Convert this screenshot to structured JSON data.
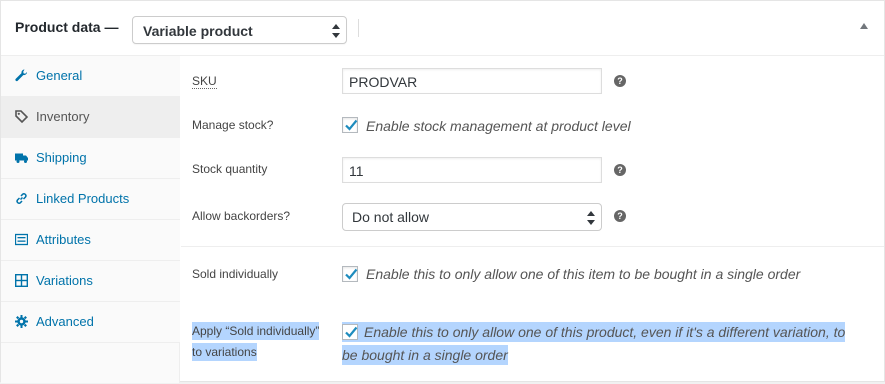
{
  "header": {
    "title": "Product data —",
    "product_type": "Variable product"
  },
  "tabs": [
    {
      "label": "General",
      "icon": "wrench-icon",
      "active": false
    },
    {
      "label": "Inventory",
      "icon": "tag-icon",
      "active": true
    },
    {
      "label": "Shipping",
      "icon": "truck-icon",
      "active": false
    },
    {
      "label": "Linked Products",
      "icon": "link-icon",
      "active": false
    },
    {
      "label": "Attributes",
      "icon": "list-icon",
      "active": false
    },
    {
      "label": "Variations",
      "icon": "grid-icon",
      "active": false
    },
    {
      "label": "Advanced",
      "icon": "gear-icon",
      "active": false
    }
  ],
  "inventory": {
    "sku_label": "SKU",
    "sku_value": "PRODVAR",
    "manage_stock_label": "Manage stock?",
    "manage_stock_desc": "Enable stock management at product level",
    "manage_stock_checked": true,
    "stock_qty_label": "Stock quantity",
    "stock_qty_value": "11",
    "backorders_label": "Allow backorders?",
    "backorders_value": "Do not allow",
    "sold_individually_label": "Sold individually",
    "sold_individually_desc": "Enable this to only allow one of this item to be bought in a single order",
    "sold_individually_checked": true,
    "apply_label_line1": "Apply “Sold individually”",
    "apply_label_line2": "to variations",
    "apply_desc_line1": "Enable this to only allow one of this product, even if it's a different variation, to",
    "apply_desc_line2": "be bought in a single order",
    "apply_checked": true
  },
  "colors": {
    "link": "#0073aa",
    "highlight": "#b4d5fe",
    "check": "#1e8cbe"
  },
  "help_glyph": "?"
}
